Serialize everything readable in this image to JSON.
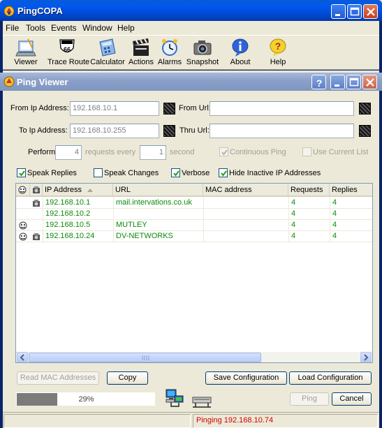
{
  "app": {
    "title": "PingCOPA"
  },
  "menu": [
    "File",
    "Tools",
    "Events",
    "Window",
    "Help"
  ],
  "toolbar": [
    {
      "label": "Viewer",
      "icon": "viewer-icon"
    },
    {
      "label": "Trace Route",
      "icon": "route66-icon"
    },
    {
      "label": "Calculator",
      "icon": "calculator-icon"
    },
    {
      "label": "Actions",
      "icon": "clapperboard-icon"
    },
    {
      "label": "Alarms",
      "icon": "alarm-clock-icon"
    },
    {
      "label": "Snapshot",
      "icon": "camera-icon"
    },
    {
      "label": "About",
      "icon": "info-icon"
    },
    {
      "label": "Help",
      "icon": "help-icon"
    }
  ],
  "viewer": {
    "title": "Ping Viewer",
    "from_ip_label": "From Ip Address:",
    "from_ip_value": "192.168.10.1",
    "to_ip_label": "To Ip Address:",
    "to_ip_value": "192.168.10.255",
    "from_url_label": "From Url:",
    "from_url_value": "",
    "thru_url_label": "Thru Url:",
    "thru_url_value": "",
    "perform_label": "Perform",
    "perform_value": "4",
    "requests_every_label": "requests every",
    "every_value": "1",
    "second_label": "second",
    "continuous_ping_label": "Continuous Ping",
    "continuous_ping_checked": true,
    "use_current_list_label": "Use Current List",
    "use_current_list_checked": false,
    "speak_replies_label": "Speak Replies",
    "speak_replies_checked": true,
    "speak_changes_label": "Speak Changes",
    "speak_changes_checked": false,
    "verbose_label": "Verbose",
    "verbose_checked": true,
    "hide_inactive_label": "Hide Inactive IP Addresses",
    "hide_inactive_checked": true
  },
  "list": {
    "columns": [
      "IP Address",
      "URL",
      "MAC address",
      "Requests",
      "Replies"
    ],
    "rows": [
      {
        "ip": "192.168.10.1",
        "url": "mail.intervations.co.uk",
        "mac": "",
        "requests": "4",
        "replies": "4",
        "icon1": false,
        "icon2": true
      },
      {
        "ip": "192.168.10.2",
        "url": "",
        "mac": "",
        "requests": "4",
        "replies": "4",
        "icon1": false,
        "icon2": false
      },
      {
        "ip": "192.168.10.5",
        "url": "MUTLEY",
        "mac": "",
        "requests": "4",
        "replies": "4",
        "icon1": true,
        "icon2": false
      },
      {
        "ip": "192.168.10.24",
        "url": "DV-NETWORKS",
        "mac": "",
        "requests": "4",
        "replies": "4",
        "icon1": true,
        "icon2": true
      }
    ]
  },
  "buttons": {
    "read_mac": "Read MAC Addresses",
    "copy": "Copy",
    "save_config": "Save Configuration",
    "load_config": "Load Configuration",
    "ping": "Ping",
    "cancel": "Cancel"
  },
  "progress": {
    "text": "29%",
    "fraction": 0.29
  },
  "status": {
    "text": "Pinging 192.168.10.74"
  },
  "colors": {
    "row_text": "#0b8a0b",
    "status_text": "#d40000",
    "title_blue": "#0058ee"
  }
}
